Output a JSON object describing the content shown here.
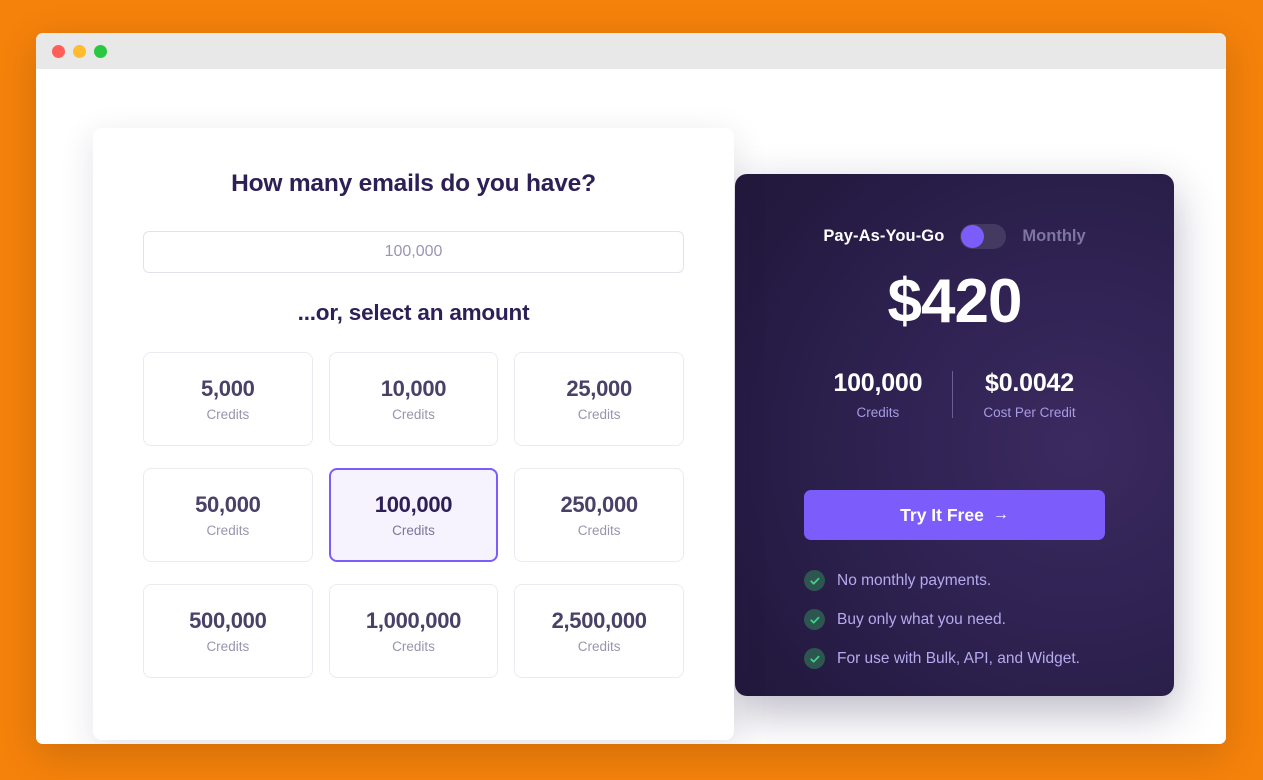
{
  "theme": {
    "page_background": "#f5820b",
    "accent_purple": "#7c5cfa",
    "panel_dark": "#2e2150",
    "heading_color": "#2d2056",
    "check_green": "#3dd68c"
  },
  "window": {
    "traffic_lights": [
      {
        "name": "close",
        "color": "#ff5f57"
      },
      {
        "name": "minimize",
        "color": "#febc2e"
      },
      {
        "name": "maximize",
        "color": "#28c840"
      }
    ]
  },
  "selector_card": {
    "heading": "How many emails do you have?",
    "input": {
      "placeholder": "100,000",
      "value": ""
    },
    "subheading": "...or, select an amount",
    "unit_label": "Credits",
    "tiers": [
      {
        "value": "5,000",
        "label": "Credits",
        "selected": false
      },
      {
        "value": "10,000",
        "label": "Credits",
        "selected": false
      },
      {
        "value": "25,000",
        "label": "Credits",
        "selected": false
      },
      {
        "value": "50,000",
        "label": "Credits",
        "selected": false
      },
      {
        "value": "100,000",
        "label": "Credits",
        "selected": true
      },
      {
        "value": "250,000",
        "label": "Credits",
        "selected": false
      },
      {
        "value": "500,000",
        "label": "Credits",
        "selected": false
      },
      {
        "value": "1,000,000",
        "label": "Credits",
        "selected": false
      },
      {
        "value": "2,500,000",
        "label": "Credits",
        "selected": false
      }
    ]
  },
  "pricing_panel": {
    "billing_toggle": {
      "left_label": "Pay-As-You-Go",
      "right_label": "Monthly",
      "active": "Pay-As-You-Go",
      "knob_position": "left"
    },
    "price": "$420",
    "stats": [
      {
        "value": "100,000",
        "label": "Credits"
      },
      {
        "value": "$0.0042",
        "label": "Cost Per Credit"
      }
    ],
    "cta": {
      "label": "Try It Free",
      "arrow": "→"
    },
    "features": [
      "No monthly payments.",
      "Buy only what you need.",
      "For use with Bulk, API, and Widget."
    ]
  }
}
